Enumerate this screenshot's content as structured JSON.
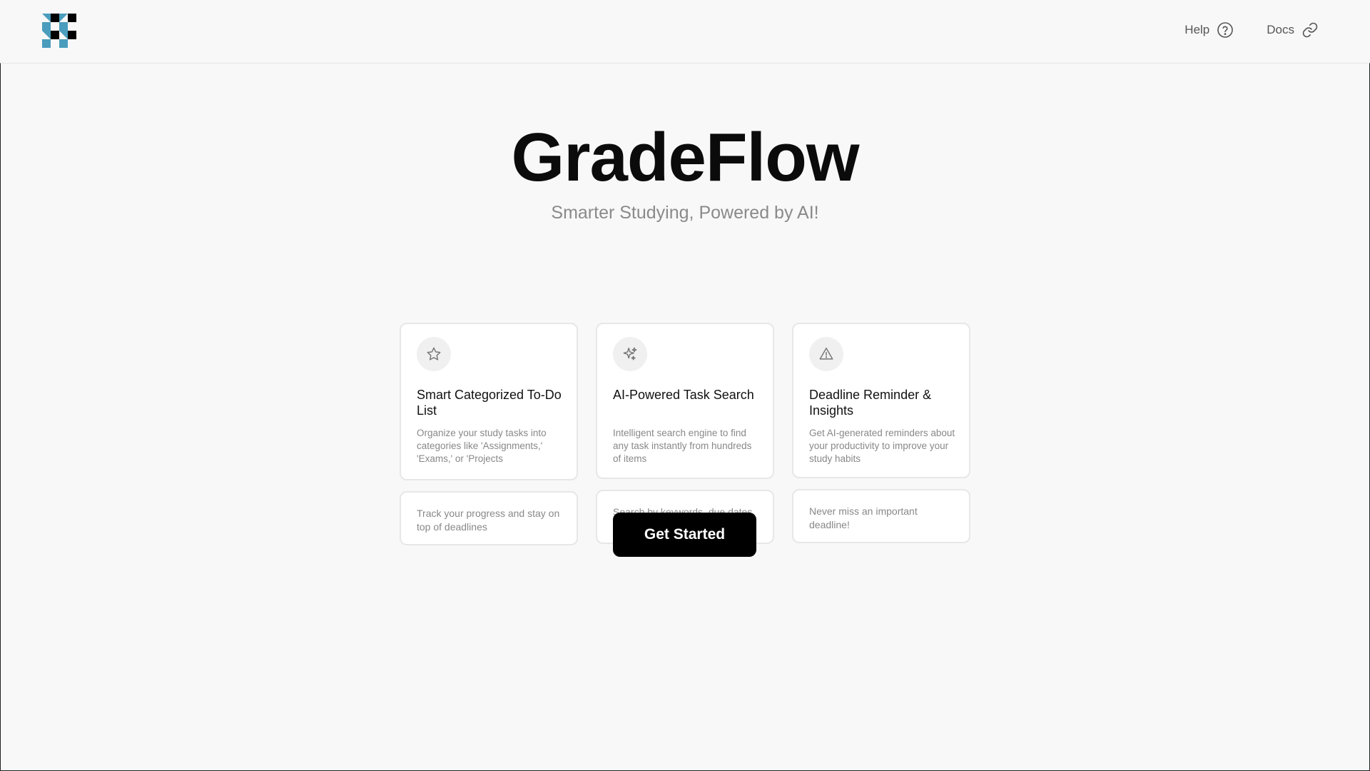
{
  "header": {
    "logo": {
      "icon": "gradeflow-logo-icon",
      "colors": [
        "#000000",
        "#4a9dbd"
      ]
    },
    "nav": [
      {
        "label": "Help",
        "icon": "question-circle-icon"
      },
      {
        "label": "Docs",
        "icon": "link-icon"
      }
    ]
  },
  "hero": {
    "title": "GradeFlow",
    "subtitle": "Smarter Studying, Powered by AI!"
  },
  "features": [
    {
      "icon": "star-icon",
      "title": "Smart Categorized To-Do List",
      "description": "Organize your study tasks into categories like 'Assignments,' 'Exams,' or 'Projects",
      "note": "Track your progress and stay on top of deadlines"
    },
    {
      "icon": "sparkles-icon",
      "title": "AI-Powered Task Search",
      "description": "Intelligent search engine to find any task instantly from hundreds of items",
      "note": "Search by keywords, due dates, or categories"
    },
    {
      "icon": "warning-triangle-icon",
      "title": "Deadline Reminder & Insights",
      "description": "Get AI-generated reminders about your productivity to improve your study habits",
      "note": "Never miss an important deadline!"
    }
  ],
  "cta": {
    "label": "Get Started"
  },
  "colors": {
    "background": "#f8f8f8",
    "card_border": "#e7e7e7",
    "muted_text": "#888888",
    "primary": "#000000"
  }
}
